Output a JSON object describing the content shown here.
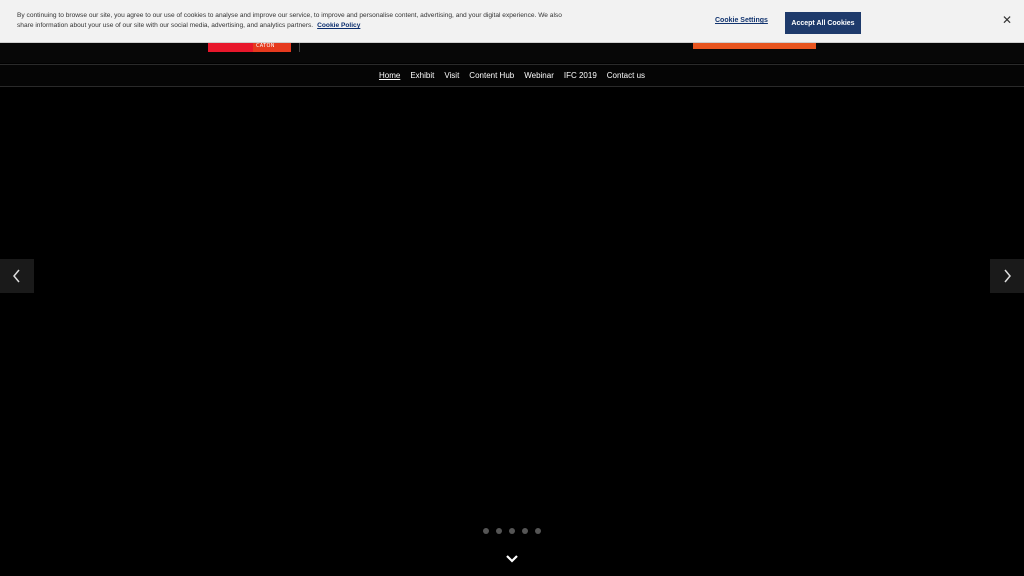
{
  "cookie_banner": {
    "text": "By continuing to browse our site, you agree to our use of cookies to analyse and improve our service, to improve and personalise content, advertising, and your digital experience. We also share information about your use of our site with our social media, advertising, and analytics partners.",
    "policy_link": "Cookie Policy",
    "settings_label": "Cookie Settings",
    "accept_label": "Accept All Cookies",
    "close_icon": "close-icon"
  },
  "header": {
    "logo_text": "CATON"
  },
  "nav": {
    "items": [
      {
        "label": "Home",
        "active": true
      },
      {
        "label": "Exhibit"
      },
      {
        "label": "Visit"
      },
      {
        "label": "Content Hub"
      },
      {
        "label": "Webinar"
      },
      {
        "label": "IFC 2019"
      },
      {
        "label": "Contact us"
      }
    ]
  },
  "carousel": {
    "prev_icon": "chevron-left-icon",
    "next_icon": "chevron-right-icon",
    "slide_count": 5,
    "scroll_icon": "chevron-down-icon"
  },
  "colors": {
    "accent_orange": "#e8551f",
    "brand_red": "#e8172b",
    "cookie_button": "#1e3a6b"
  }
}
